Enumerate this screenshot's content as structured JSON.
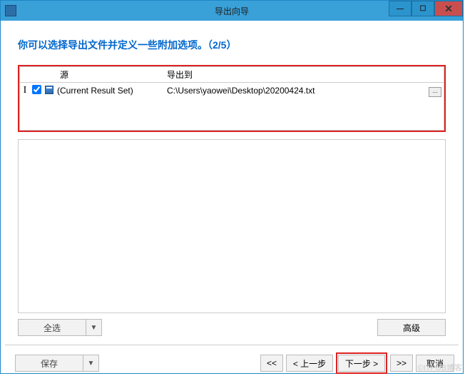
{
  "window": {
    "title": "导出向导"
  },
  "heading": "你可以选择导出文件并定义一些附加选项。（2/5）",
  "grid": {
    "headers": {
      "source": "源",
      "dest": "导出到"
    },
    "row": {
      "checked": true,
      "source": "(Current Result Set)",
      "dest": "C:\\Users\\yaowei\\Desktop\\20200424.txt",
      "ellipsis": "..."
    }
  },
  "buttons": {
    "select_all": "全选",
    "advanced": "高级",
    "save": "保存",
    "dropdown_glyph": "▼",
    "first": "<<",
    "prev": "< 上一步",
    "next": "下一步 >",
    "last": ">>",
    "cancel": "取消"
  },
  "watermark": "©ITPUB博客"
}
